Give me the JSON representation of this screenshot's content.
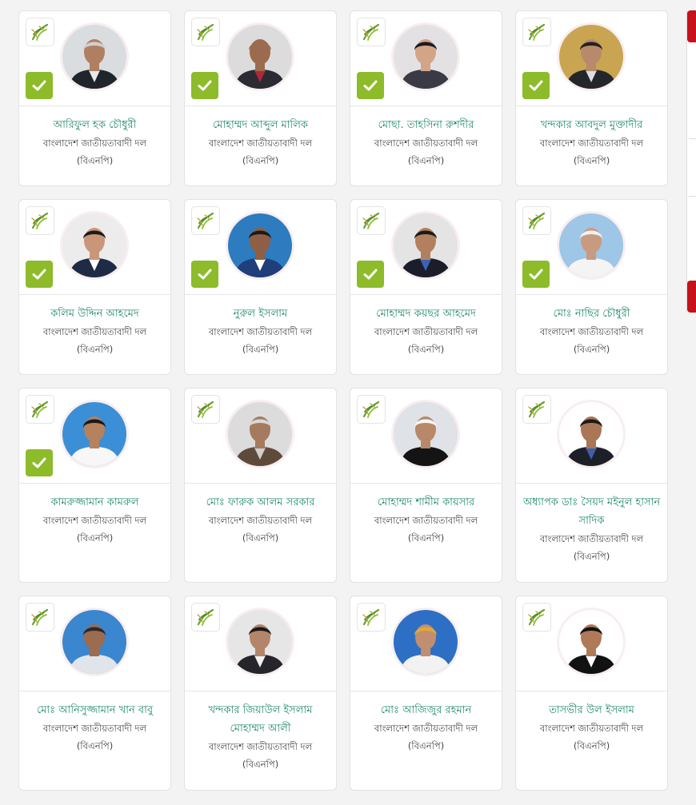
{
  "party_logo_icon": "sheaf-of-paddy-icon",
  "check_icon": "checkmark-icon",
  "colors": {
    "name": "#1f8a68",
    "check_badge": "#8dbb2a",
    "side_accent": "#c8111b"
  },
  "candidates": [
    {
      "name": "আরিফুল হক চৌধুরী",
      "party": "বাংলাদেশ জাতীয়তাবাদী দল (বিএনপি)",
      "checked": true,
      "bg": "#d9dde0",
      "skin": "#b07f62",
      "hair": "#cfcfcf",
      "suit": "#20242c",
      "shirt": "#e7e9ea"
    },
    {
      "name": "মোহাম্মদ আব্দুল মালিক",
      "party": "বাংলাদেশ জাতীয়তাবাদী দল (বিএনপি)",
      "checked": true,
      "bg": "#dcdcdc",
      "skin": "#9c6a4e",
      "hair": "#9c6a4e",
      "suit": "#2b2b33",
      "shirt": "#b0263a"
    },
    {
      "name": "মোছা. তাহসিনা রুশদীর",
      "party": "বাংলাদেশ জাতীয়তাবাদী দল (বিএনপি)",
      "checked": true,
      "bg": "#e4e1e4",
      "skin": "#d2a588",
      "hair": "#1c1c22",
      "suit": "#3a3a44",
      "shirt": "#3a3a44"
    },
    {
      "name": "খন্দকার আবদুল মুক্তাদীর",
      "party": "বাংলাদেশ জাতীয়তাবাদী দল (বিএনপি)",
      "checked": true,
      "bg": "#c9a552",
      "skin": "#b98a6a",
      "hair": "#222222",
      "suit": "#24262c",
      "shirt": "#dcdde0"
    },
    {
      "name": "কলিম উদ্দিন আহমেদ",
      "party": "বাংলাদেশ জাতীয়তাবাদী দল (বিএনপি)",
      "checked": true,
      "bg": "#ececec",
      "skin": "#c9967a",
      "hair": "#1c1c1c",
      "suit": "#1f2a45",
      "shirt": "#ffffff"
    },
    {
      "name": "নুরুল ইসলাম",
      "party": "বাংলাদেশ জাতীয়তাবাদী দল (বিএনপি)",
      "checked": true,
      "bg": "#2e7cc0",
      "skin": "#8e5f44",
      "hair": "#1a1a1a",
      "suit": "#1f3e7a",
      "shirt": "#ffffff"
    },
    {
      "name": "মোহাম্মদ কয়ছর আহমেদ",
      "party": "বাংলাদেশ জাতীয়তাবাদী দল (বিএনপি)",
      "checked": true,
      "bg": "#e4e4e4",
      "skin": "#b3805f",
      "hair": "#1a1a1a",
      "suit": "#1b1e2a",
      "shirt": "#3b62b8"
    },
    {
      "name": "মোঃ নাছির চৌধুরী",
      "party": "বাংলাদেশ জাতীয়তাবাদী দল (বিএনপি)",
      "checked": true,
      "bg": "#9ec6e6",
      "skin": "#c89b80",
      "hair": "#f2f2f2",
      "suit": "#f4f4f4",
      "shirt": "#f4f4f4"
    },
    {
      "name": "কামরুজ্জামান কামরুল",
      "party": "বাংলাদেশ জাতীয়তাবাদী দল (বিএনপি)",
      "checked": true,
      "bg": "#3b8fd6",
      "skin": "#b5825f",
      "hair": "#1a1a1a",
      "suit": "#f7f7f7",
      "shirt": "#f7f7f7"
    },
    {
      "name": "মোঃ ফারুক আলম সরকার",
      "party": "বাংলাদেশ জাতীয়তাবাদী দল (বিএনপি)",
      "checked": false,
      "bg": "#dcdcdc",
      "skin": "#a67a5e",
      "hair": "#d8d8d8",
      "suit": "#5e4a3a",
      "shirt": "#cfcfcf"
    },
    {
      "name": "মোহাম্মদ শামীম কায়সার",
      "party": "বাংলাদেশ জাতীয়তাবাদী দল (বিএনপি)",
      "checked": false,
      "bg": "#dfe2e6",
      "skin": "#b7886a",
      "hair": "#f6f6f6",
      "suit": "#141414",
      "shirt": "#141414"
    },
    {
      "name": "অধ্যাপক ডাঃ সৈয়দ মইনুল হাসান সাদিক",
      "party": "বাংলাদেশ জাতীয়তাবাদী দল (বিএনপি)",
      "checked": false,
      "bg": "#ffffff",
      "skin": "#a97656",
      "hair": "#1a1a1a",
      "suit": "#1d2029",
      "shirt": "#3d5fa8"
    },
    {
      "name": "মোঃ আনিসুজ্জামান খান বাবু",
      "party": "বাংলাদেশ জাতীয়তাবাদী দল (বিএনপি)",
      "checked": false,
      "bg": "#3a86cf",
      "skin": "#9b6c50",
      "hair": "#2a2a2a",
      "suit": "#dfe5ea",
      "shirt": "#dfe5ea"
    },
    {
      "name": "খন্দকার জিয়াউল ইসলাম মোহাম্মদ আলী",
      "party": "বাংলাদেশ জাতীয়তাবাদী দল (বিএনপি)",
      "checked": false,
      "bg": "#e6e6e6",
      "skin": "#b3856a",
      "hair": "#1a1a1a",
      "suit": "#25252b",
      "shirt": "#f0f0f0"
    },
    {
      "name": "মোঃ আজিজুর রহমান",
      "party": "বাংলাদেশ জাতীয়তাবাদী দল (বিএনপি)",
      "checked": false,
      "bg": "#2d6fc4",
      "skin": "#c18f70",
      "hair": "#e0a93a",
      "suit": "#f2f2f2",
      "shirt": "#f2f2f2"
    },
    {
      "name": "তাসভীর উল ইসলাম",
      "party": "বাংলাদেশ জাতীয়তাবাদী দল (বিএনপি)",
      "checked": false,
      "bg": "#ffffff",
      "skin": "#b07a58",
      "hair": "#121212",
      "suit": "#121212",
      "shirt": "#ffffff"
    }
  ]
}
